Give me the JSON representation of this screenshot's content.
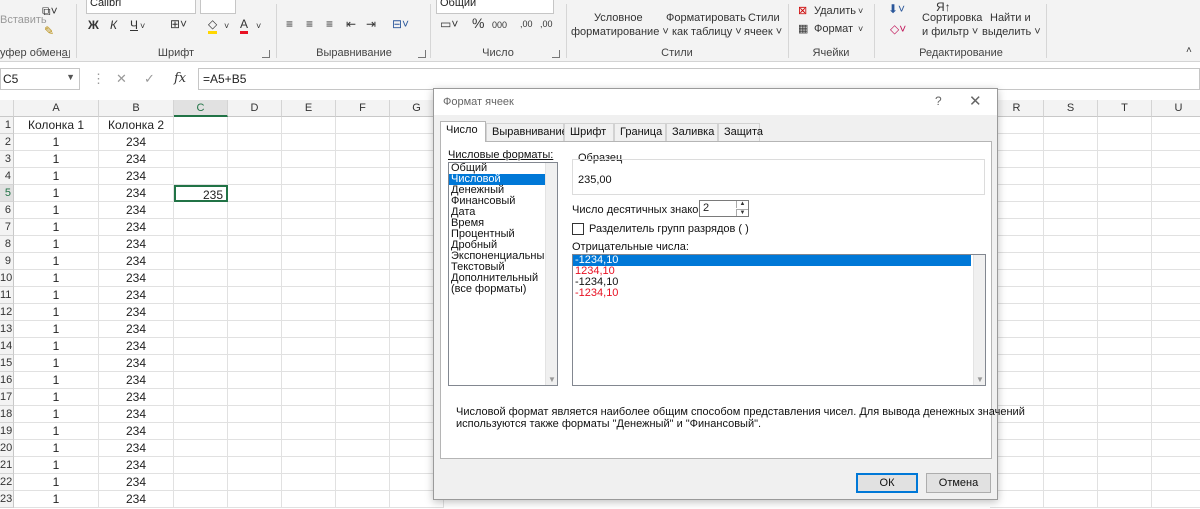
{
  "ribbon": {
    "clipboard": {
      "label": "уфер обмена",
      "paste": "Вставить"
    },
    "font": {
      "label": "Шрифт",
      "name": "Calibri",
      "bold": "Ж",
      "italic": "К",
      "underline": "Ч",
      "font_color_glyph": "A"
    },
    "alignment": {
      "label": "Выравнивание"
    },
    "number": {
      "label": "Число",
      "format": "Общий",
      "percent": "%",
      "thousands": "000",
      "inc_decimal": ",00",
      "dec_decimal": ",00"
    },
    "styles": {
      "label": "Стили",
      "conditional": "Условное",
      "conditional2": "форматирование ˅",
      "as_table": "Форматировать",
      "as_table2": "как таблицу ˅",
      "cell_styles": "Стили",
      "cell_styles2": "ячеек ˅"
    },
    "cells": {
      "label": "Ячейки",
      "delete": "Удалить",
      "format": "Формат"
    },
    "editing": {
      "label": "Редактирование",
      "sort": "Сортировка",
      "sort2": "и фильтр ˅",
      "find": "Найти и",
      "find2": "выделить ˅"
    }
  },
  "formula_bar": {
    "name_box": "C5",
    "fx": "fx",
    "formula": "=A5+B5"
  },
  "sheet": {
    "columns": [
      "A",
      "B",
      "C",
      "D",
      "E",
      "F",
      "G",
      "R",
      "S",
      "T",
      "U"
    ],
    "selected_column": "C",
    "rows": [
      {
        "n": "1",
        "a": "Колонка 1",
        "b": "Колонка 2",
        "c": ""
      },
      {
        "n": "2",
        "a": "1",
        "b": "234",
        "c": ""
      },
      {
        "n": "3",
        "a": "1",
        "b": "234",
        "c": ""
      },
      {
        "n": "4",
        "a": "1",
        "b": "234",
        "c": ""
      },
      {
        "n": "5",
        "a": "1",
        "b": "234",
        "c": "235"
      },
      {
        "n": "6",
        "a": "1",
        "b": "234",
        "c": ""
      },
      {
        "n": "7",
        "a": "1",
        "b": "234",
        "c": ""
      },
      {
        "n": "8",
        "a": "1",
        "b": "234",
        "c": ""
      },
      {
        "n": "9",
        "a": "1",
        "b": "234",
        "c": ""
      },
      {
        "n": "10",
        "a": "1",
        "b": "234",
        "c": ""
      },
      {
        "n": "11",
        "a": "1",
        "b": "234",
        "c": ""
      },
      {
        "n": "12",
        "a": "1",
        "b": "234",
        "c": ""
      },
      {
        "n": "13",
        "a": "1",
        "b": "234",
        "c": ""
      },
      {
        "n": "14",
        "a": "1",
        "b": "234",
        "c": ""
      },
      {
        "n": "15",
        "a": "1",
        "b": "234",
        "c": ""
      },
      {
        "n": "16",
        "a": "1",
        "b": "234",
        "c": ""
      },
      {
        "n": "17",
        "a": "1",
        "b": "234",
        "c": ""
      },
      {
        "n": "18",
        "a": "1",
        "b": "234",
        "c": ""
      },
      {
        "n": "19",
        "a": "1",
        "b": "234",
        "c": ""
      },
      {
        "n": "20",
        "a": "1",
        "b": "234",
        "c": ""
      },
      {
        "n": "21",
        "a": "1",
        "b": "234",
        "c": ""
      },
      {
        "n": "22",
        "a": "1",
        "b": "234",
        "c": ""
      },
      {
        "n": "23",
        "a": "1",
        "b": "234",
        "c": ""
      }
    ]
  },
  "dialog": {
    "title": "Формат ячеек",
    "help": "?",
    "close": "✕",
    "tabs": [
      "Число",
      "Выравнивание",
      "Шрифт",
      "Граница",
      "Заливка",
      "Защита"
    ],
    "active_tab": "Число",
    "formats_label": "Числовые форматы:",
    "formats": [
      "Общий",
      "Числовой",
      "Денежный",
      "Финансовый",
      "Дата",
      "Время",
      "Процентный",
      "Дробный",
      "Экспоненциальный",
      "Текстовый",
      "Дополнительный",
      "(все форматы)"
    ],
    "selected_format": "Числовой",
    "sample_label": "Образец",
    "sample_value": "235,00",
    "decimals_label": "Число десятичных знаков:",
    "decimals_value": "2",
    "separator_label": "Разделитель групп разрядов ( )",
    "separator_checked": false,
    "negative_label": "Отрицательные числа:",
    "negative_options": [
      {
        "text": "-1234,10",
        "color": "#ffffff",
        "selected": true
      },
      {
        "text": "1234,10",
        "color": "#e81123",
        "selected": false
      },
      {
        "text": "-1234,10",
        "color": "#111111",
        "selected": false
      },
      {
        "text": "-1234,10",
        "color": "#e81123",
        "selected": false
      }
    ],
    "description_line1": "Числовой формат является наиболее общим способом представления чисел. Для вывода денежных значений",
    "description_line2": "используются также форматы \"Денежный\" и \"Финансовый\".",
    "ok": "ОК",
    "cancel": "Отмена"
  },
  "colors": {
    "accent": "#217346",
    "selection": "#0078d7",
    "negative": "#e81123"
  }
}
